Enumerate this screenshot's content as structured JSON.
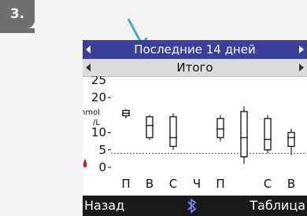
{
  "step": {
    "label": "3."
  },
  "screen": {
    "title": "Последние 14 дней",
    "subtitle": "Итого",
    "softkey_left": "Назад",
    "softkey_right": "Таблица"
  },
  "chart_data": {
    "type": "box",
    "unit_label": [
      "mmol",
      "/L"
    ],
    "y_ticks": [
      "25",
      "20",
      "10",
      "5",
      "0"
    ],
    "ylim": [
      0,
      25
    ],
    "target_line": 4,
    "categories": [
      "П",
      "В",
      "С",
      "Ч",
      "П",
      "",
      "С",
      "В"
    ],
    "boxes": [
      {
        "whisker_low": 14.0,
        "q1": 14.8,
        "median": 15.5,
        "q3": 16.3,
        "whisker_high": 16.7
      },
      {
        "whisker_low": 7.8,
        "q1": 8.5,
        "median": 12.0,
        "q3": 14.5,
        "whisker_high": 15.0
      },
      {
        "whisker_low": 5.0,
        "q1": 6.0,
        "median": 8.5,
        "q3": 14.5,
        "whisker_high": 15.5
      },
      null,
      {
        "whisker_low": 7.5,
        "q1": 8.5,
        "median": 11.0,
        "q3": 14.0,
        "whisker_high": 15.0
      },
      {
        "whisker_low": 1.0,
        "q1": 3.0,
        "median": 8.5,
        "q3": 16.0,
        "whisker_high": 17.5
      },
      {
        "whisker_low": 4.0,
        "q1": 5.0,
        "median": 8.0,
        "q3": 14.0,
        "whisker_high": 15.0
      },
      {
        "whisker_low": 3.5,
        "q1": 6.0,
        "median": 8.5,
        "q3": 10.0,
        "whisker_high": 11.0
      }
    ],
    "colors": {
      "title_bar": "#3a3f9a",
      "hypo_marker": "#c81e1e"
    }
  }
}
